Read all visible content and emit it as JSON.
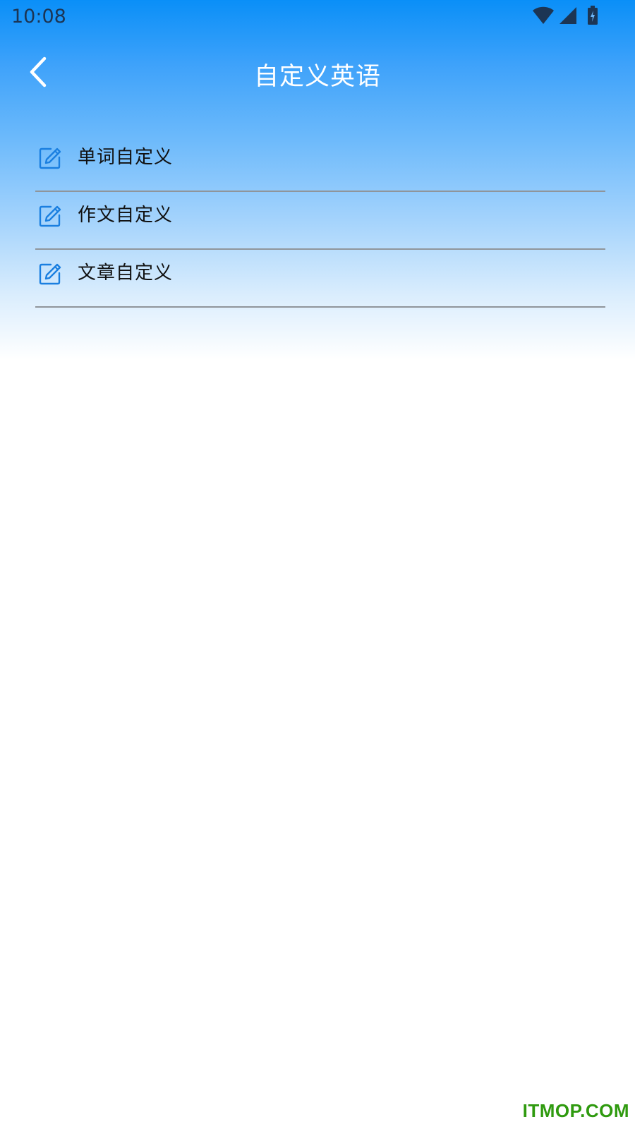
{
  "status_bar": {
    "time": "10:08",
    "icons": [
      "wifi-icon",
      "cellular-signal-icon",
      "battery-charging-icon"
    ]
  },
  "app_bar": {
    "back_icon": "chevron-left-icon",
    "title": "自定义英语"
  },
  "menu": {
    "items": [
      {
        "label": "单词自定义",
        "icon": "edit-icon"
      },
      {
        "label": "作文自定义",
        "icon": "edit-icon"
      },
      {
        "label": "文章自定义",
        "icon": "edit-icon"
      }
    ]
  },
  "watermark": "ITMOP.COM",
  "colors": {
    "header_top": "#0a8ff8",
    "icon_blue": "#1a7fe0",
    "divider": "#8f959b",
    "watermark": "#2f9a0f"
  }
}
